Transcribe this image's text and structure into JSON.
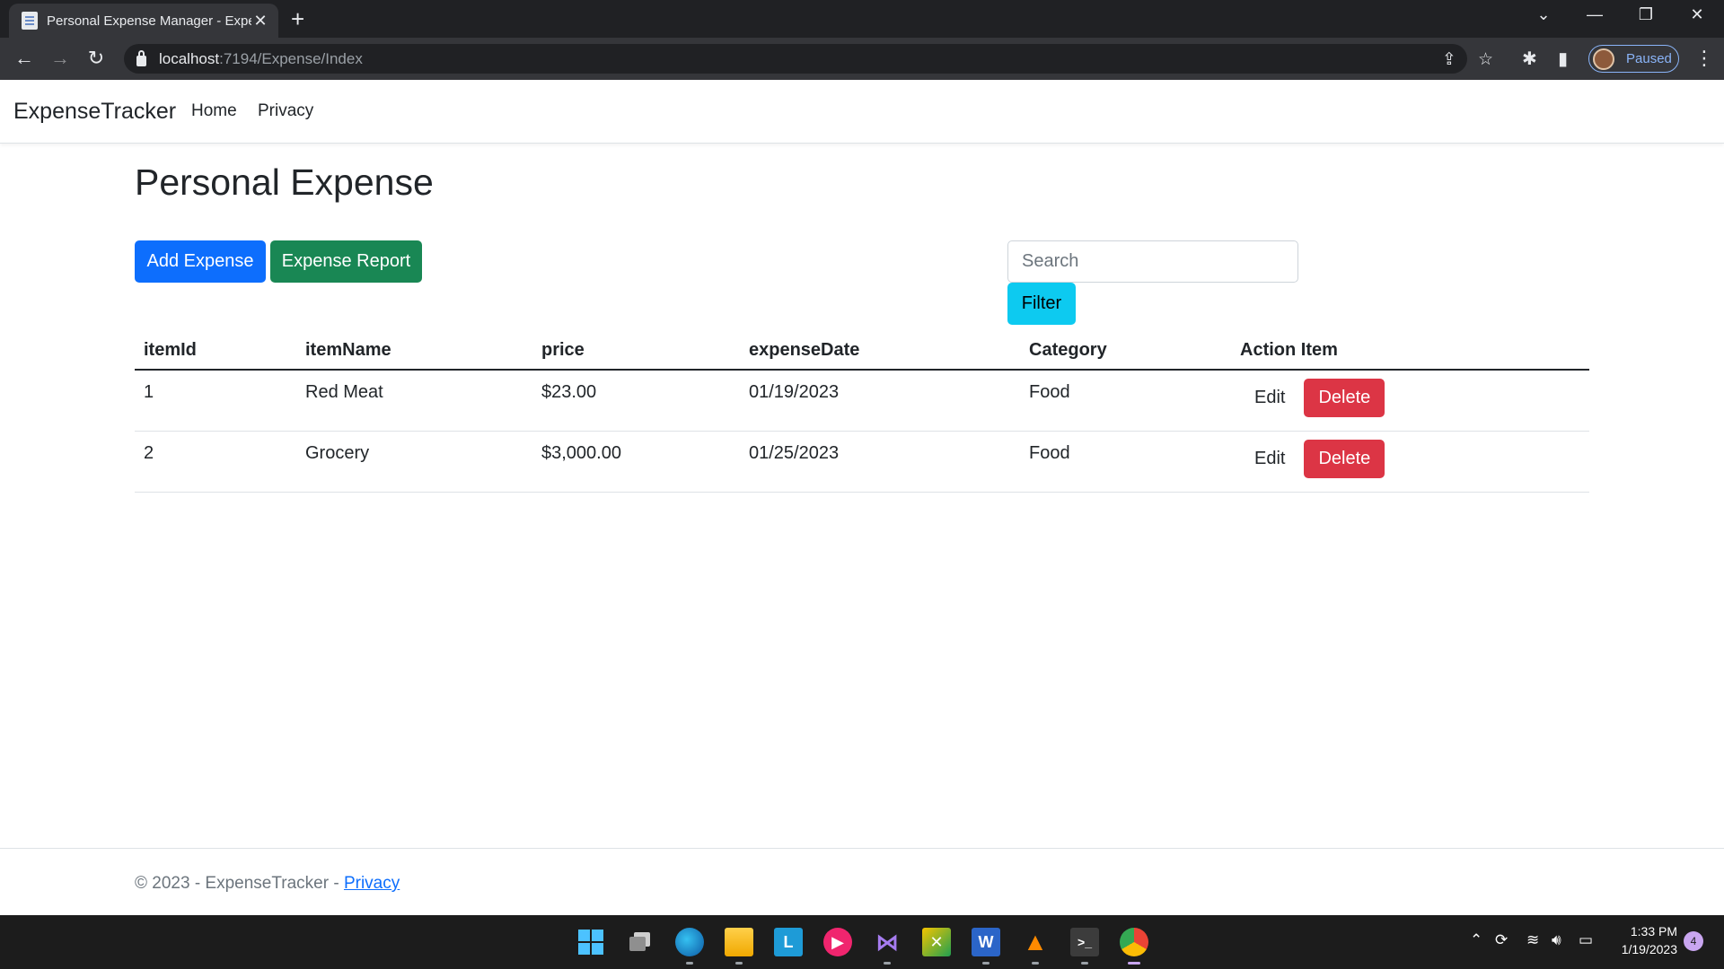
{
  "browser": {
    "tab_title": "Personal Expense Manager - Expense",
    "new_tab_symbol": "+",
    "url_host": "localhost",
    "url_path": ":7194/Expense/Index",
    "profile_label": "Paused"
  },
  "navbar": {
    "brand": "ExpenseTracker",
    "links": [
      "Home",
      "Privacy"
    ]
  },
  "page": {
    "title": "Personal Expense",
    "add_button": "Add Expense",
    "report_button": "Expense Report",
    "search_placeholder": "Search",
    "filter_button": "Filter"
  },
  "table": {
    "headers": [
      "itemId",
      "itemName",
      "price",
      "expenseDate",
      "Category",
      "Action Item"
    ],
    "rows": [
      {
        "id": "1",
        "name": "Red Meat",
        "price": "$23.00",
        "date": "01/19/2023",
        "category": "Food",
        "edit": "Edit",
        "delete": "Delete"
      },
      {
        "id": "2",
        "name": "Grocery",
        "price": "$3,000.00",
        "date": "01/25/2023",
        "category": "Food",
        "edit": "Edit",
        "delete": "Delete"
      }
    ]
  },
  "footer": {
    "text": "© 2023 - ExpenseTracker - ",
    "link": "Privacy"
  },
  "taskbar": {
    "time": "1:33 PM",
    "date": "1/19/2023",
    "notification_count": "4",
    "apps": [
      "start",
      "task-view",
      "edge",
      "file-explorer",
      "l-app",
      "media-player",
      "visual-studio",
      "excel-like",
      "word",
      "vlc",
      "terminal",
      "chrome"
    ]
  },
  "colors": {
    "primary": "#0d6efd",
    "success": "#198754",
    "info": "#0dcaf0",
    "danger": "#dc3545"
  }
}
